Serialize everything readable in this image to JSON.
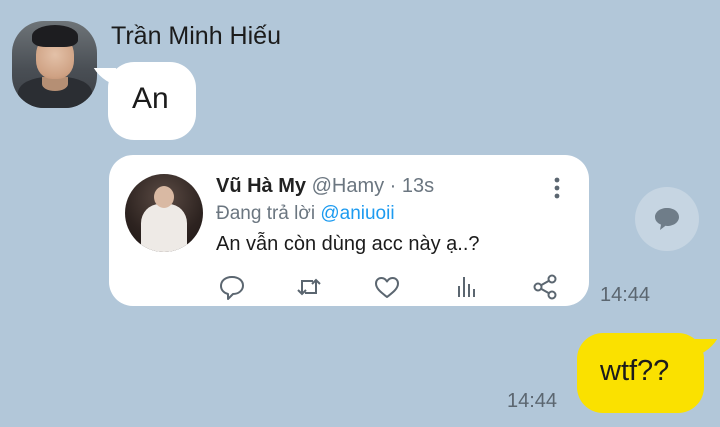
{
  "contact": {
    "name": "Trần Minh Hiếu",
    "avatar_icon": "profile-photo"
  },
  "incoming_message": {
    "text": "An"
  },
  "shared_tweet": {
    "display_name": "Vũ Hà My",
    "handle_time": "@Hamy · 13s",
    "reply_prefix": "Đang trả lời",
    "reply_mention": "@aniuoii",
    "body": "An vẫn còn dùng acc này ạ..?",
    "time": "14:44",
    "action_icons": [
      "reply-icon",
      "retweet-icon",
      "like-icon",
      "stats-icon",
      "share-icon"
    ],
    "colors": {
      "mention": "#1d9bf0",
      "muted": "#6b7680"
    }
  },
  "outgoing_message": {
    "text": "wtf??",
    "time": "14:44"
  },
  "theme": {
    "background": "#b2c7d9",
    "incoming_bubble": "#ffffff",
    "outgoing_bubble": "#fae100"
  }
}
